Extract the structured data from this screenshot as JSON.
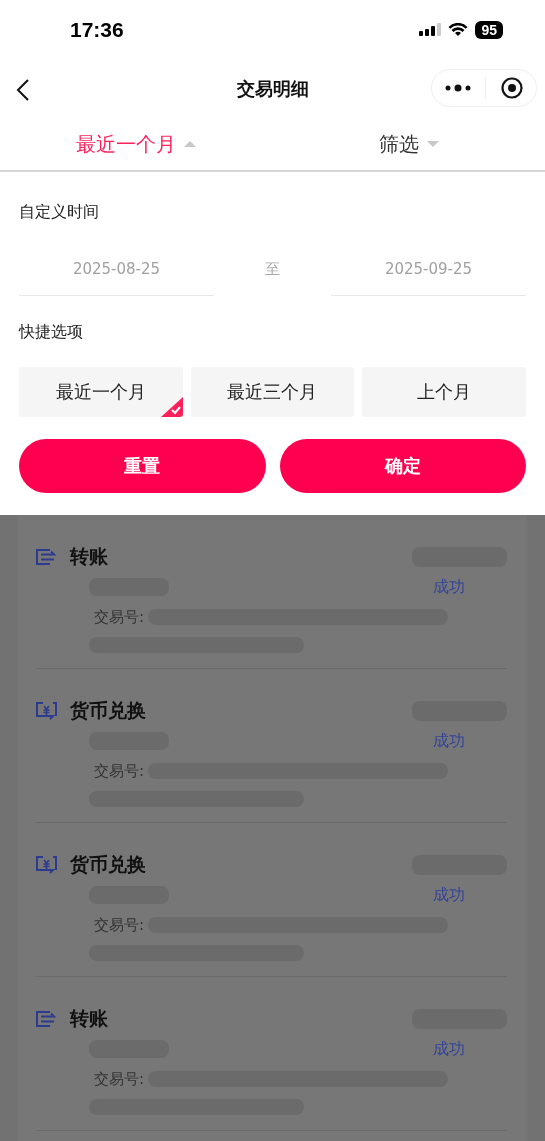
{
  "status_bar": {
    "time": "17:36",
    "battery": "95"
  },
  "nav": {
    "title": "交易明细"
  },
  "tabs": [
    {
      "label": "最近一个月",
      "selected": true
    },
    {
      "label": "筛选",
      "selected": false
    }
  ],
  "filter": {
    "custom_time_label": "自定义时间",
    "start_date": "2025-08-25",
    "separator": "至",
    "end_date": "2025-09-25",
    "quick_label": "快捷选项",
    "quick_options": [
      {
        "label": "最近一个月",
        "selected": true
      },
      {
        "label": "最近三个月",
        "selected": false
      },
      {
        "label": "上个月",
        "selected": false
      }
    ],
    "buttons": [
      "重置",
      "确定"
    ]
  },
  "transactions": [
    {
      "kind": "transfer",
      "title": "转账",
      "id_label": "交易号:",
      "status": "成功"
    },
    {
      "kind": "exchange",
      "title": "货币兑换",
      "id_label": "交易号:",
      "status": "成功"
    },
    {
      "kind": "exchange",
      "title": "货币兑换",
      "id_label": "交易号:",
      "status": "成功"
    },
    {
      "kind": "transfer",
      "title": "转账",
      "id_label": "交易号:",
      "status": "成功"
    }
  ]
}
